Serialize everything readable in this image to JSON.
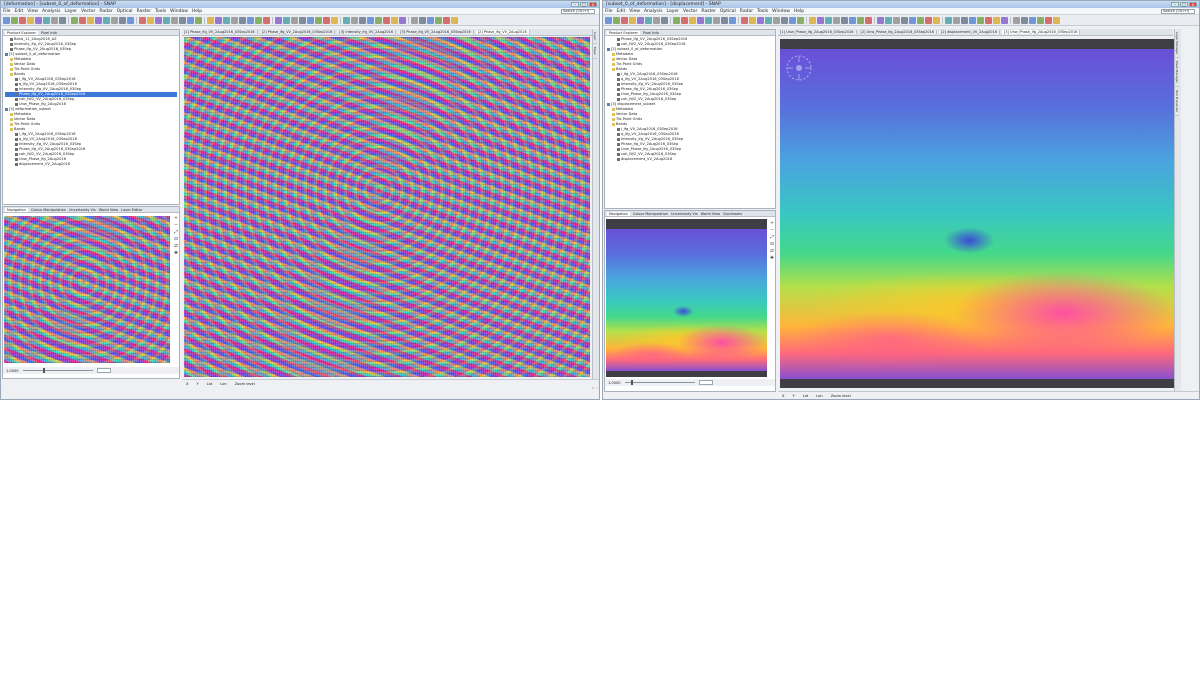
{
  "win_a": {
    "title": "[deformation] - [subset_0_of_deformation] - SNAP",
    "menus": [
      "File",
      "Edit",
      "View",
      "Analysis",
      "Layer",
      "Vector",
      "Radar",
      "Optical",
      "Raster",
      "Tools",
      "Window",
      "Help"
    ],
    "search_placeholder": "Search (Ctrl+I)",
    "panel_tabs": [
      "Product Explorer",
      "Pixel Info"
    ],
    "tree": [
      {
        "label": "Band_11_2Aug2016_AZ",
        "kind": "band",
        "indent": 1
      },
      {
        "label": "Intensity_ifg_VV_2Aug2016_03Sep",
        "kind": "band",
        "indent": 1
      },
      {
        "label": "Phase_ifg_VV_2Aug2016_03Sep",
        "kind": "band",
        "indent": 1
      },
      {
        "label": "[2] subset_0_of_deformation",
        "kind": "product",
        "indent": 0
      },
      {
        "label": "Metadata",
        "kind": "folder",
        "indent": 1
      },
      {
        "label": "Vector Data",
        "kind": "folder",
        "indent": 1
      },
      {
        "label": "Tie-Point Grids",
        "kind": "folder",
        "indent": 1
      },
      {
        "label": "Bands",
        "kind": "folder",
        "indent": 1
      },
      {
        "label": "i_ifg_VV_2Aug2016_03Sep2016",
        "kind": "band",
        "indent": 2
      },
      {
        "label": "q_ifg_VV_2Aug2016_03Sep2016",
        "kind": "band",
        "indent": 2
      },
      {
        "label": "Intensity_ifg_VV_2Aug2016_03Sep",
        "kind": "band",
        "indent": 2
      },
      {
        "label": "Phase_ifg_VV_2Aug2016_03Sep2016",
        "kind": "band",
        "indent": 2,
        "selected": true
      },
      {
        "label": "coh_IW2_VV_2Aug2016_03Sep",
        "kind": "band",
        "indent": 2
      },
      {
        "label": "Unw_Phase_ifg_2Aug2016",
        "kind": "band",
        "indent": 2
      },
      {
        "label": "[3] deformation_subset",
        "kind": "product",
        "indent": 0
      },
      {
        "label": "Metadata",
        "kind": "folder",
        "indent": 1
      },
      {
        "label": "Vector Data",
        "kind": "folder",
        "indent": 1
      },
      {
        "label": "Tie-Point Grids",
        "kind": "folder",
        "indent": 1
      },
      {
        "label": "Bands",
        "kind": "folder",
        "indent": 1
      },
      {
        "label": "i_ifg_VV_2Aug2016_03Sep2016",
        "kind": "band",
        "indent": 2
      },
      {
        "label": "q_ifg_VV_2Aug2016_03Sep2016",
        "kind": "band",
        "indent": 2
      },
      {
        "label": "Intensity_ifg_VV_2Aug2016_03Sep",
        "kind": "band",
        "indent": 2
      },
      {
        "label": "Phase_ifg_VV_2Aug2016_03Sep2016",
        "kind": "band",
        "indent": 2
      },
      {
        "label": "coh_IW2_VV_2Aug2016_03Sep",
        "kind": "band",
        "indent": 2
      },
      {
        "label": "Unw_Phase_ifg_2Aug2016",
        "kind": "band",
        "indent": 2
      },
      {
        "label": "displacement_VV_2Aug2016",
        "kind": "band",
        "indent": 2
      }
    ],
    "nav_tabs": [
      "Navigation",
      "Colour Manipulation",
      "Uncertainty Vis",
      "World View",
      "Layer Editor"
    ],
    "image_tabs": [
      "[1] Phase_ifg_VV_2Aug2016_03Sep2016",
      "[2] Phase_ifg_VV_2Aug2016_03Sep2016",
      "[3] Intensity_ifg_VV_2Aug2016",
      "[3] Phase_ifg_VV_2Aug2016_03Sep2016",
      "[2] Phase_ifg_VV_2Aug2016"
    ],
    "nav_zoom": "1.0000",
    "status": [
      "X",
      "Y",
      "Lat",
      "Lon",
      "Zoom level"
    ]
  },
  "win_b": {
    "title": "[subset_0_of_deformation] - [displacement] - SNAP",
    "menus": [
      "File",
      "Edit",
      "View",
      "Analysis",
      "Layer",
      "Vector",
      "Raster",
      "Optical",
      "Radar",
      "Tools",
      "Window",
      "Help"
    ],
    "search_placeholder": "Search (Ctrl+I)",
    "panel_tabs": [
      "Product Explorer",
      "Pixel Info"
    ],
    "tree": [
      {
        "label": "Phase_ifg_VV_2Aug2016_03Sep2016",
        "kind": "band",
        "indent": 2
      },
      {
        "label": "coh_IW2_VV_2Aug2016_03Sep2016",
        "kind": "band",
        "indent": 2
      },
      {
        "label": "[2] subset_0_of_deformation",
        "kind": "product",
        "indent": 0
      },
      {
        "label": "Metadata",
        "kind": "folder",
        "indent": 1
      },
      {
        "label": "Vector Data",
        "kind": "folder",
        "indent": 1
      },
      {
        "label": "Tie-Point Grids",
        "kind": "folder",
        "indent": 1
      },
      {
        "label": "Bands",
        "kind": "folder",
        "indent": 1
      },
      {
        "label": "i_ifg_VV_2Aug2016_03Sep2016",
        "kind": "band",
        "indent": 2
      },
      {
        "label": "q_ifg_VV_2Aug2016_03Sep2016",
        "kind": "band",
        "indent": 2
      },
      {
        "label": "Intensity_ifg_VV_2Aug2016_03Sep",
        "kind": "band",
        "indent": 2
      },
      {
        "label": "Phase_ifg_VV_2Aug2016_03Sep",
        "kind": "band",
        "indent": 2
      },
      {
        "label": "Unw_Phase_ifg_2Aug2016_03Sep",
        "kind": "band",
        "indent": 2
      },
      {
        "label": "coh_IW2_VV_2Aug2016_03Sep",
        "kind": "band",
        "indent": 2
      },
      {
        "label": "[3] displacement_subset",
        "kind": "product",
        "indent": 0
      },
      {
        "label": "Metadata",
        "kind": "folder",
        "indent": 1
      },
      {
        "label": "Vector Data",
        "kind": "folder",
        "indent": 1
      },
      {
        "label": "Tie-Point Grids",
        "kind": "folder",
        "indent": 1
      },
      {
        "label": "Bands",
        "kind": "folder",
        "indent": 1
      },
      {
        "label": "i_ifg_VV_2Aug2016_03Sep2016",
        "kind": "band",
        "indent": 2
      },
      {
        "label": "q_ifg_VV_2Aug2016_03Sep2016",
        "kind": "band",
        "indent": 2
      },
      {
        "label": "Intensity_ifg_VV_2Aug2016_03Sep",
        "kind": "band",
        "indent": 2
      },
      {
        "label": "Phase_ifg_VV_2Aug2016_03Sep",
        "kind": "band",
        "indent": 2
      },
      {
        "label": "Unw_Phase_ifg_2Aug2016_03Sep",
        "kind": "band",
        "indent": 2
      },
      {
        "label": "coh_IW2_VV_2Aug2016_03Sep",
        "kind": "band",
        "indent": 2
      },
      {
        "label": "displacement_VV_2Aug2016",
        "kind": "band",
        "indent": 2
      }
    ],
    "nav_tabs": [
      "Navigation",
      "Colour Manipulation",
      "Uncertainty Vis",
      "World View",
      "Quicklooks"
    ],
    "image_tabs": [
      "[1] Unw_Phase_ifg_2Aug2016_03Sep2016",
      "[2] Unw_Phase_ifg_2Aug2016_03Sep2016",
      "[2] displacement_VV_2Aug2016",
      "[3] Unw_Phase_ifg_2Aug2016_03Sep2016"
    ],
    "right_tabs": [
      "Layer Manager",
      "Mask Manager",
      "Tool Properties"
    ],
    "nav_zoom": "1.0000",
    "status": [
      "X",
      "Y",
      "Lat",
      "Lon",
      "Zoom level"
    ]
  }
}
